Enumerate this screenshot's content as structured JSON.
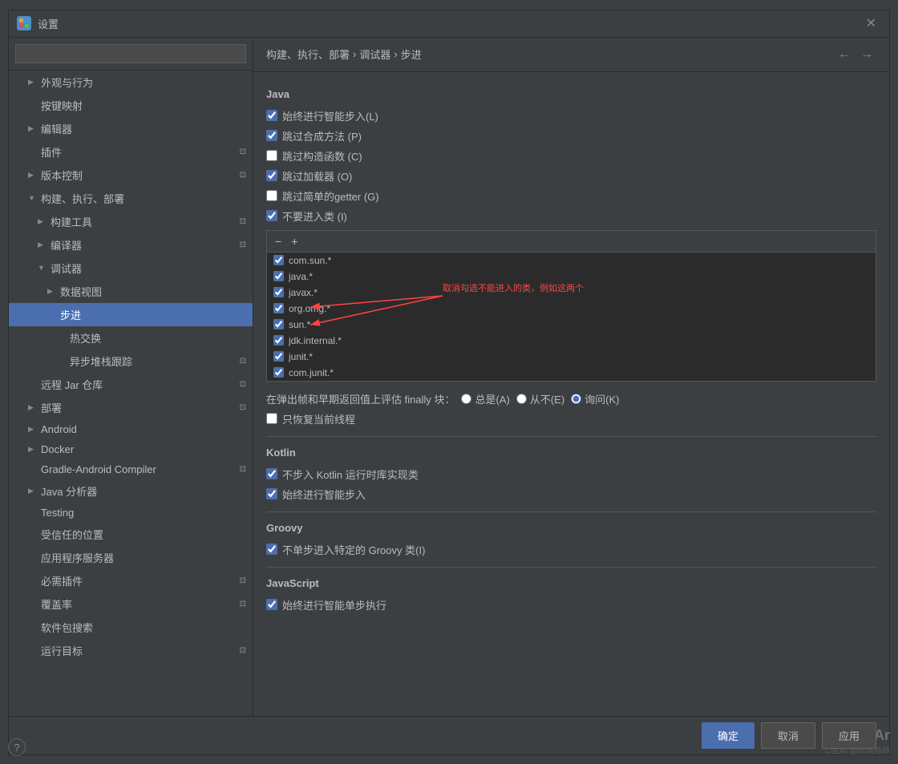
{
  "dialog": {
    "title": "设置",
    "icon_text": "✦"
  },
  "breadcrumb": {
    "path": [
      "构建、执行、部署",
      "调试器",
      "步进"
    ],
    "separator": "›"
  },
  "sidebar": {
    "search_placeholder": "",
    "items": [
      {
        "id": "appearance",
        "label": "外观与行为",
        "level": 0,
        "expandable": true,
        "expanded": false,
        "badge": false
      },
      {
        "id": "keymap",
        "label": "按键映射",
        "level": 0,
        "expandable": false,
        "badge": false
      },
      {
        "id": "editor",
        "label": "编辑器",
        "level": 0,
        "expandable": true,
        "expanded": false,
        "badge": false
      },
      {
        "id": "plugins",
        "label": "插件",
        "level": 0,
        "expandable": false,
        "badge": true
      },
      {
        "id": "vcs",
        "label": "版本控制",
        "level": 0,
        "expandable": true,
        "expanded": false,
        "badge": true
      },
      {
        "id": "build",
        "label": "构建、执行、部署",
        "level": 0,
        "expandable": true,
        "expanded": true,
        "badge": false
      },
      {
        "id": "build-tools",
        "label": "构建工具",
        "level": 1,
        "expandable": true,
        "expanded": false,
        "badge": true
      },
      {
        "id": "compiler",
        "label": "编译器",
        "level": 1,
        "expandable": true,
        "expanded": false,
        "badge": true
      },
      {
        "id": "debugger",
        "label": "调试器",
        "level": 1,
        "expandable": true,
        "expanded": true,
        "badge": false
      },
      {
        "id": "data-view",
        "label": "数据视图",
        "level": 2,
        "expandable": true,
        "expanded": false,
        "badge": false
      },
      {
        "id": "stepping",
        "label": "步进",
        "level": 2,
        "expandable": false,
        "selected": true,
        "badge": false
      },
      {
        "id": "hot-swap",
        "label": "热交换",
        "level": 3,
        "expandable": false,
        "badge": false
      },
      {
        "id": "async-stack",
        "label": "异步堆栈跟踪",
        "level": 3,
        "expandable": false,
        "badge": true
      },
      {
        "id": "remote-jar",
        "label": "远程 Jar 仓库",
        "level": 0,
        "expandable": false,
        "badge": true
      },
      {
        "id": "deploy",
        "label": "部署",
        "level": 0,
        "expandable": true,
        "expanded": false,
        "badge": true
      },
      {
        "id": "android",
        "label": "Android",
        "level": 0,
        "expandable": true,
        "expanded": false,
        "badge": false
      },
      {
        "id": "docker",
        "label": "Docker",
        "level": 0,
        "expandable": true,
        "expanded": false,
        "badge": false
      },
      {
        "id": "gradle-compiler",
        "label": "Gradle-Android Compiler",
        "level": 0,
        "expandable": false,
        "badge": true
      },
      {
        "id": "java-analyzer",
        "label": "Java 分析器",
        "level": 0,
        "expandable": true,
        "expanded": false,
        "badge": false
      },
      {
        "id": "testing",
        "label": "Testing",
        "level": 0,
        "expandable": false,
        "badge": false
      },
      {
        "id": "trusted-locations",
        "label": "受信任的位置",
        "level": 0,
        "expandable": false,
        "badge": false
      },
      {
        "id": "app-server",
        "label": "应用程序服务器",
        "level": 0,
        "expandable": false,
        "badge": false
      },
      {
        "id": "required-plugins",
        "label": "必需插件",
        "level": 0,
        "expandable": false,
        "badge": true
      },
      {
        "id": "coverage",
        "label": "覆盖率",
        "level": 0,
        "expandable": false,
        "badge": true
      },
      {
        "id": "package-search",
        "label": "软件包搜索",
        "level": 0,
        "expandable": false,
        "badge": false
      },
      {
        "id": "run-targets",
        "label": "运行目标",
        "level": 0,
        "expandable": false,
        "badge": true
      }
    ]
  },
  "panel": {
    "section_java": "Java",
    "section_kotlin": "Kotlin",
    "section_groovy": "Groovy",
    "section_javascript": "JavaScript",
    "java_options": [
      {
        "id": "smart-step-in",
        "label": "始终进行智能步入(L)",
        "checked": true
      },
      {
        "id": "skip-synthetic",
        "label": "跳过合成方法 (P)",
        "checked": true
      },
      {
        "id": "skip-constructor",
        "label": "跳过构造函数 (C)",
        "checked": false
      },
      {
        "id": "skip-classloader",
        "label": "跳过加载器 (O)",
        "checked": true
      },
      {
        "id": "skip-getter",
        "label": "跳过简单的getter (G)",
        "checked": false
      },
      {
        "id": "no-step-into",
        "label": "不要进入类 (I)",
        "checked": true
      }
    ],
    "list_items": [
      {
        "label": "com.sun.*",
        "checked": true
      },
      {
        "label": "java.*",
        "checked": true
      },
      {
        "label": "javax.*",
        "checked": true
      },
      {
        "label": "org.omg.*",
        "checked": true
      },
      {
        "label": "sun.*",
        "checked": true
      },
      {
        "label": "jdk.internal.*",
        "checked": true
      },
      {
        "label": "junit.*",
        "checked": true
      },
      {
        "label": "com.junit.*",
        "checked": true
      }
    ],
    "list_toolbar": {
      "remove_btn": "−",
      "add_btn": "+"
    },
    "finally_label": "在弹出帧和早期返回值上评估 finally 块：",
    "finally_options": [
      {
        "id": "always",
        "label": "总是(A)",
        "checked": false
      },
      {
        "id": "never",
        "label": "从不(E)",
        "checked": false
      },
      {
        "id": "ask",
        "label": "询问(K)",
        "checked": true
      }
    ],
    "restore_threads_label": "只恢复当前线程",
    "restore_threads_checked": false,
    "kotlin_options": [
      {
        "id": "no-step-kotlin",
        "label": "不步入 Kotlin 运行时库实现类",
        "checked": true
      },
      {
        "id": "kotlin-smart",
        "label": "始终进行智能步入",
        "checked": true
      }
    ],
    "groovy_options": [
      {
        "id": "no-step-groovy",
        "label": "不单步进入特定的 Groovy 类(I)",
        "checked": true
      }
    ],
    "js_options": [
      {
        "id": "js-smart",
        "label": "始终进行智能单步执行",
        "checked": true
      }
    ],
    "annotation_text": "取消勾选不能进入的类，例如这两个"
  },
  "bottom_bar": {
    "ok_label": "确定",
    "cancel_label": "取消",
    "apply_label": "应用"
  },
  "watermark": {
    "text": "TAr",
    "subtitle": "CSDN @时间师师"
  }
}
